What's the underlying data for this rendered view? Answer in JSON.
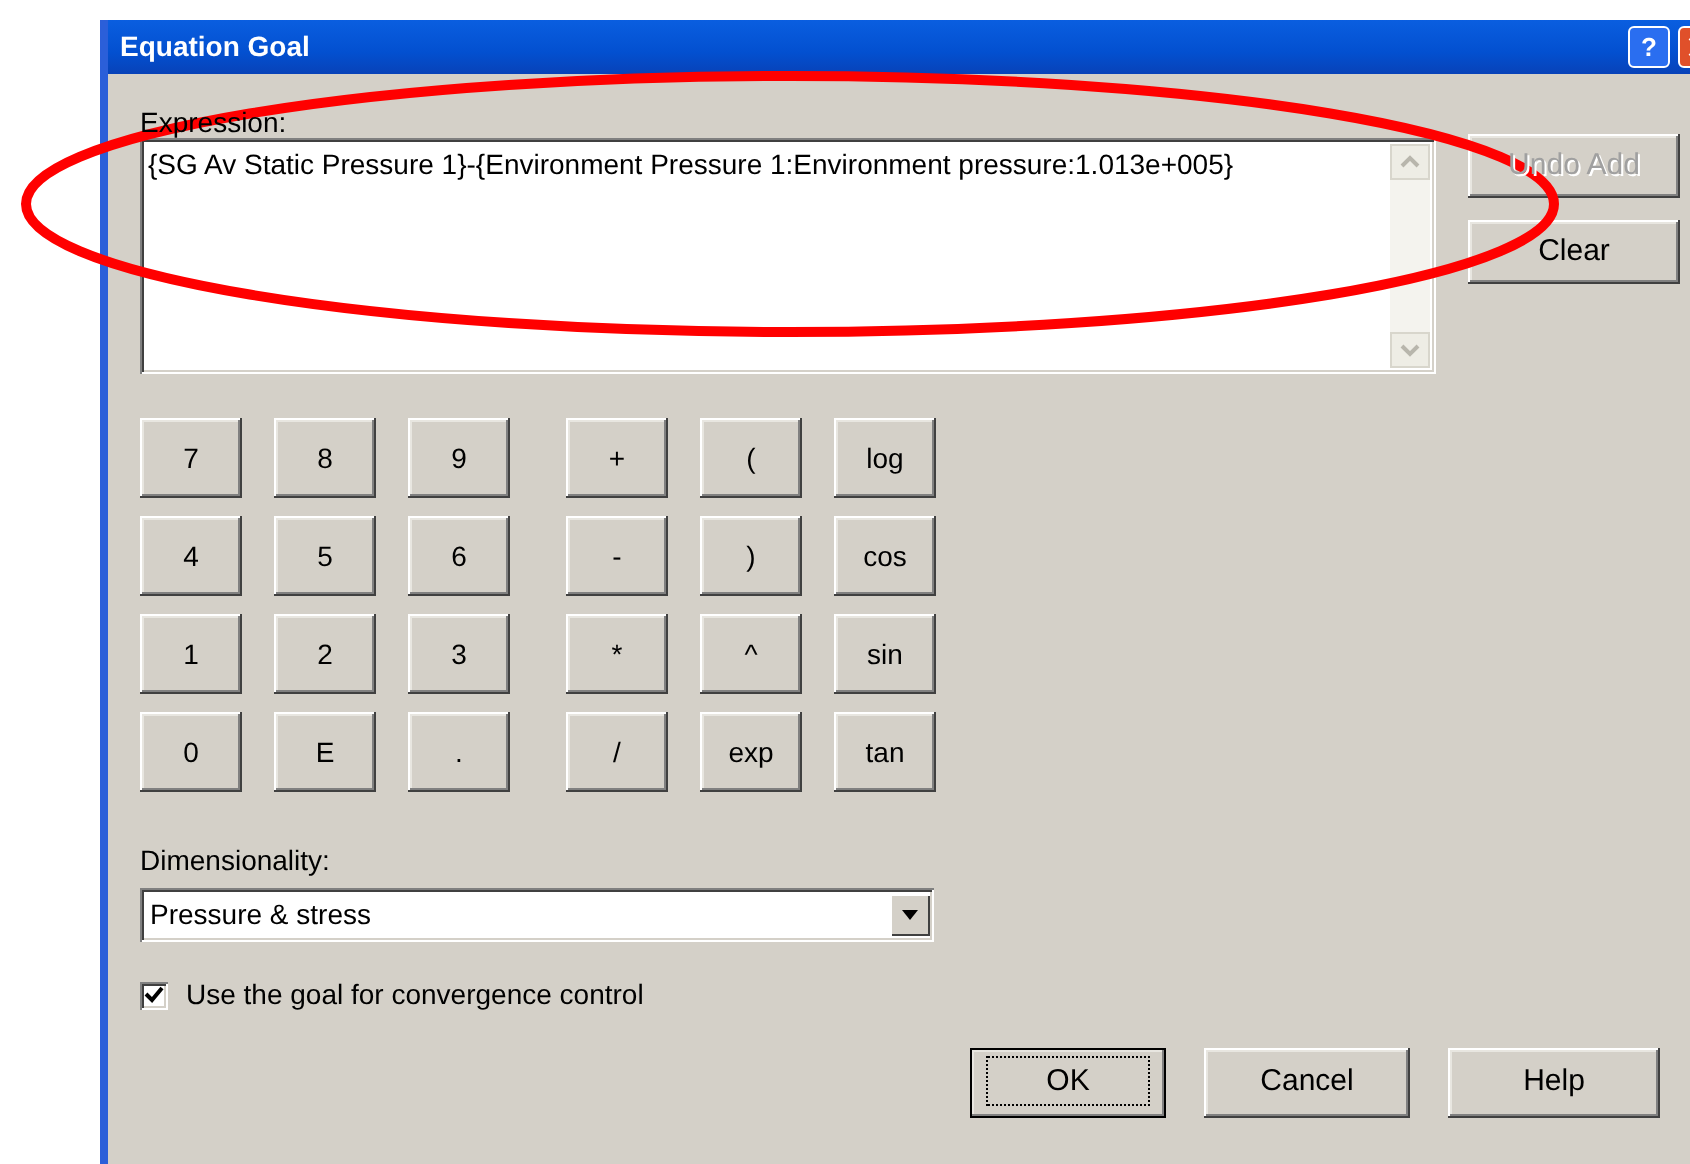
{
  "window": {
    "title": "Equation Goal"
  },
  "title_buttons": [
    {
      "kind": "help",
      "label": "?"
    },
    {
      "kind": "close"
    }
  ],
  "expression": {
    "label": "Expression:",
    "value": "{SG Av Static Pressure 1}-{Environment Pressure 1:Environment pressure:1.013e+005}"
  },
  "side_buttons": [
    {
      "label": "Undo Add",
      "disabled": true
    },
    {
      "label": "Clear",
      "disabled": false
    }
  ],
  "keypad": {
    "digits": [
      [
        "7",
        "8",
        "9"
      ],
      [
        "4",
        "5",
        "6"
      ],
      [
        "1",
        "2",
        "3"
      ],
      [
        "0",
        "E",
        "."
      ]
    ],
    "operators": [
      [
        "+",
        "(",
        "log"
      ],
      [
        "-",
        ")",
        "cos"
      ],
      [
        "*",
        "^",
        "sin"
      ],
      [
        "/",
        "exp",
        "tan"
      ]
    ]
  },
  "dimensionality": {
    "label": "Dimensionality:",
    "value": "Pressure & stress"
  },
  "convergence": {
    "label": "Use the goal for convergence control",
    "checked": true
  },
  "buttons": [
    {
      "label": "OK",
      "focused": true
    },
    {
      "label": "Cancel",
      "focused": false
    },
    {
      "label": "Help",
      "focused": false
    }
  ],
  "annotations": [
    {
      "kind": "ellipse",
      "color": "#ff0000"
    }
  ]
}
